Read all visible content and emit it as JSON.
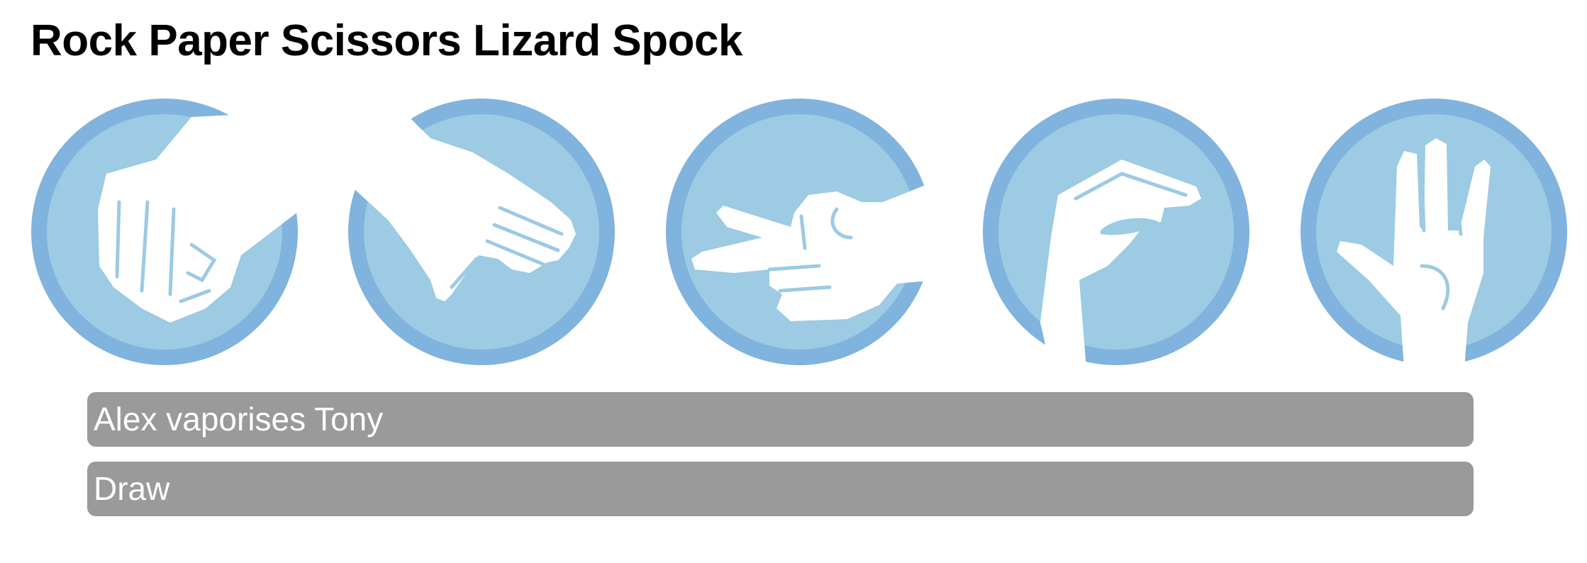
{
  "page": {
    "title": "Rock Paper Scissors Lizard Spock"
  },
  "choices": [
    {
      "name": "rock",
      "icon": "rock-fist-icon"
    },
    {
      "name": "paper",
      "icon": "paper-hand-icon"
    },
    {
      "name": "scissors",
      "icon": "scissors-hand-icon"
    },
    {
      "name": "lizard",
      "icon": "lizard-hand-icon"
    },
    {
      "name": "spock",
      "icon": "spock-hand-icon"
    }
  ],
  "results": {
    "line1": "Alex vaporises Tony",
    "line2": "Draw"
  },
  "colors": {
    "ring": "#80b3dd",
    "disc": "#9ccbe3",
    "hand": "#ffffff",
    "result_bg": "#9a9a9a",
    "result_text": "#ffffff"
  }
}
